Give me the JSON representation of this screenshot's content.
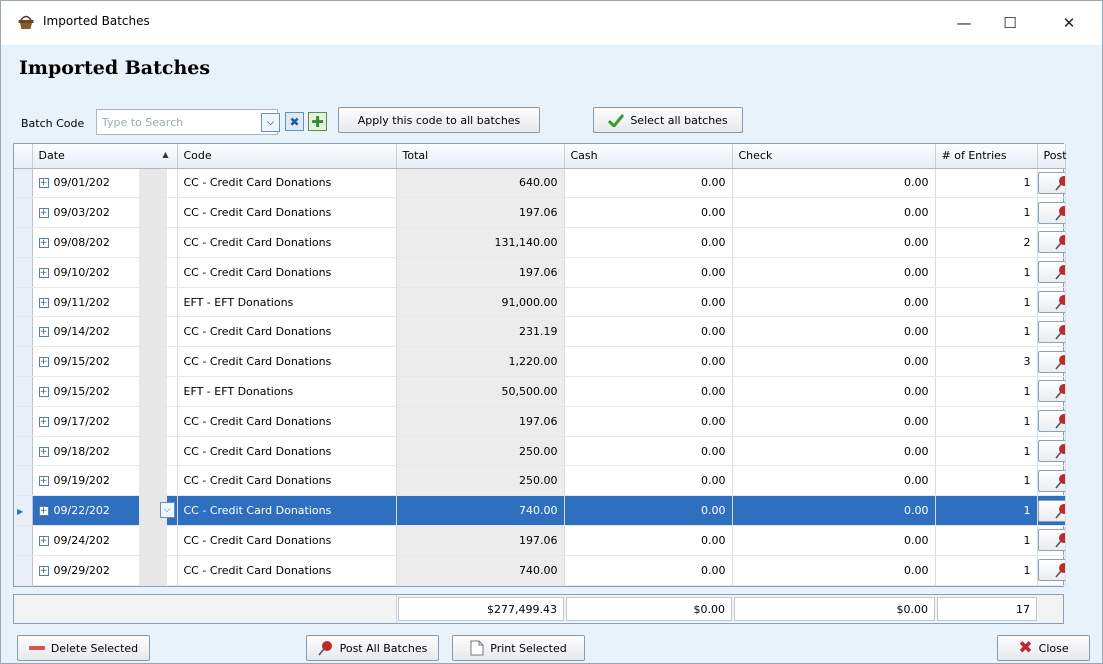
{
  "window": {
    "title": "Imported Batches"
  },
  "heading": "Imported Batches",
  "toolbar": {
    "batch_code_label": "Batch Code",
    "search_placeholder": "Type to Search",
    "apply_code_label": "Apply this code to all batches",
    "select_all_label": "Select all batches"
  },
  "grid": {
    "columns": [
      "Date",
      "Code",
      "Total",
      "Cash",
      "Check",
      "# of Entries",
      "Post"
    ],
    "rows": [
      {
        "date": "09/01/202",
        "code": "CC - Credit Card Donations",
        "total": "640.00",
        "cash": "0.00",
        "check": "0.00",
        "entries": "1"
      },
      {
        "date": "09/03/202",
        "code": "CC - Credit Card Donations",
        "total": "197.06",
        "cash": "0.00",
        "check": "0.00",
        "entries": "1"
      },
      {
        "date": "09/08/202",
        "code": "CC - Credit Card Donations",
        "total": "131,140.00",
        "cash": "0.00",
        "check": "0.00",
        "entries": "2"
      },
      {
        "date": "09/10/202",
        "code": "CC - Credit Card Donations",
        "total": "197.06",
        "cash": "0.00",
        "check": "0.00",
        "entries": "1"
      },
      {
        "date": "09/11/202",
        "code": "EFT - EFT Donations",
        "total": "91,000.00",
        "cash": "0.00",
        "check": "0.00",
        "entries": "1"
      },
      {
        "date": "09/14/202",
        "code": "CC - Credit Card Donations",
        "total": "231.19",
        "cash": "0.00",
        "check": "0.00",
        "entries": "1"
      },
      {
        "date": "09/15/202",
        "code": "CC - Credit Card Donations",
        "total": "1,220.00",
        "cash": "0.00",
        "check": "0.00",
        "entries": "3"
      },
      {
        "date": "09/15/202",
        "code": "EFT - EFT Donations",
        "total": "50,500.00",
        "cash": "0.00",
        "check": "0.00",
        "entries": "1"
      },
      {
        "date": "09/17/202",
        "code": "CC - Credit Card Donations",
        "total": "197.06",
        "cash": "0.00",
        "check": "0.00",
        "entries": "1"
      },
      {
        "date": "09/18/202",
        "code": "CC - Credit Card Donations",
        "total": "250.00",
        "cash": "0.00",
        "check": "0.00",
        "entries": "1"
      },
      {
        "date": "09/19/202",
        "code": "CC - Credit Card Donations",
        "total": "250.00",
        "cash": "0.00",
        "check": "0.00",
        "entries": "1"
      },
      {
        "date": "09/22/202",
        "code": "CC - Credit Card Donations",
        "total": "740.00",
        "cash": "0.00",
        "check": "0.00",
        "entries": "1"
      },
      {
        "date": "09/24/202",
        "code": "CC - Credit Card Donations",
        "total": "197.06",
        "cash": "0.00",
        "check": "0.00",
        "entries": "1"
      },
      {
        "date": "09/29/202",
        "code": "CC - Credit Card Donations",
        "total": "740.00",
        "cash": "0.00",
        "check": "0.00",
        "entries": "1"
      }
    ],
    "active_row": 11,
    "totals": {
      "total": "$277,499.43",
      "cash": "$0.00",
      "check": "$0.00",
      "entries": "17"
    }
  },
  "buttons": {
    "delete_selected": "Delete Selected",
    "post_all": "Post All Batches",
    "print_selected": "Print Selected",
    "close": "Close"
  },
  "colors": {
    "accent": "#2f6fc0",
    "delete_red": "#d9534f",
    "close_red": "#c0282b"
  }
}
